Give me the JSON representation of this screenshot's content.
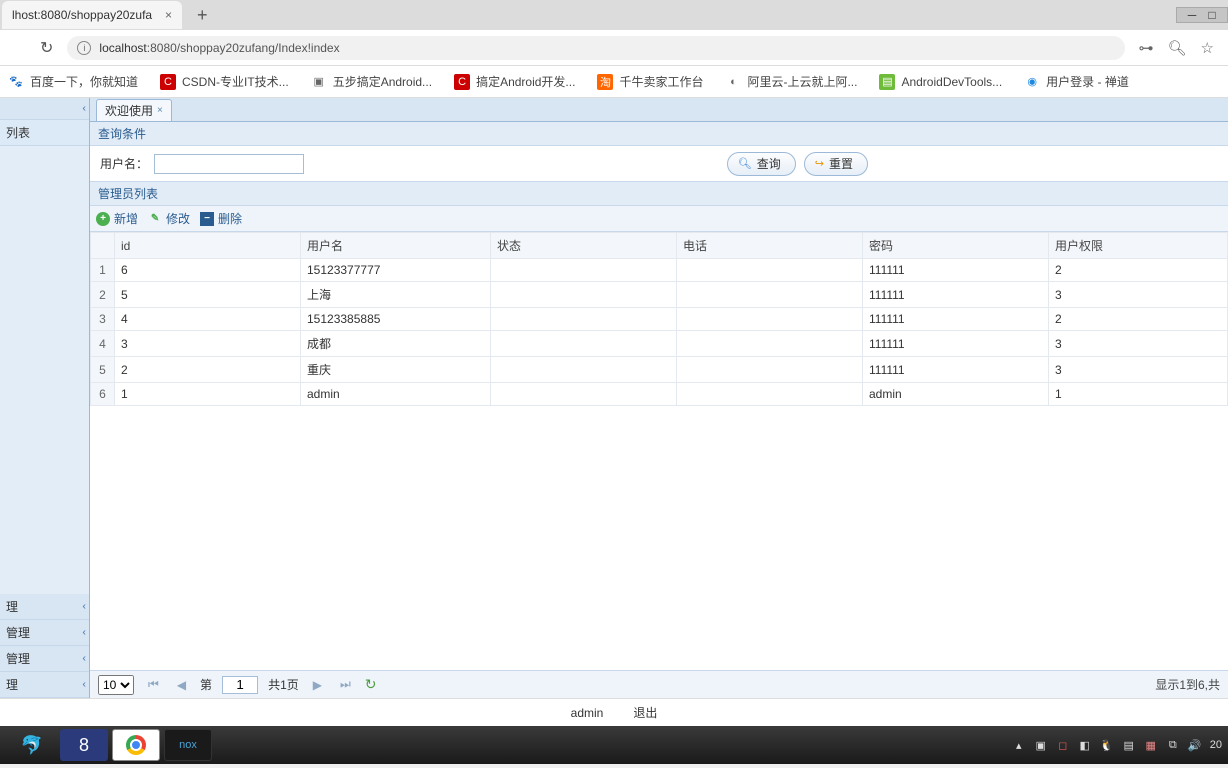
{
  "browser": {
    "tab_title": "lhost:8080/shoppay20zufa",
    "url_display_host": "localhost",
    "url_display_rest": ":8080/shoppay20zufang/Index!index"
  },
  "bookmarks": [
    {
      "label": "百度一下，你就知道"
    },
    {
      "label": "CSDN-专业IT技术..."
    },
    {
      "label": "五步搞定Android..."
    },
    {
      "label": "搞定Android开发..."
    },
    {
      "label": "千牛卖家工作台"
    },
    {
      "label": "阿里云-上云就上阿..."
    },
    {
      "label": "AndroidDevTools..."
    },
    {
      "label": "用户登录 - 禅道"
    }
  ],
  "sidebar": {
    "top_item": "列表",
    "bottom_items": [
      "理",
      "管理",
      "管理",
      "理"
    ]
  },
  "app": {
    "tab_label": "欢迎使用",
    "query_panel_title": "查询条件",
    "username_label": "用户名：",
    "search_label": "查询",
    "reset_label": "重置",
    "list_panel_title": "管理员列表",
    "toolbar": {
      "add": "新增",
      "edit": "修改",
      "delete": "删除"
    },
    "columns": {
      "id": "id",
      "username": "用户名",
      "status": "状态",
      "phone": "电话",
      "password": "密码",
      "perm": "用户权限"
    },
    "rows": [
      {
        "n": "1",
        "id": "6",
        "username": "15123377777",
        "status": "",
        "phone": "",
        "password": "111111",
        "perm": "2"
      },
      {
        "n": "2",
        "id": "5",
        "username": "上海",
        "status": "",
        "phone": "",
        "password": "111111",
        "perm": "3"
      },
      {
        "n": "3",
        "id": "4",
        "username": "15123385885",
        "status": "",
        "phone": "",
        "password": "111111",
        "perm": "2"
      },
      {
        "n": "4",
        "id": "3",
        "username": "成都",
        "status": "",
        "phone": "",
        "password": "111111",
        "perm": "3"
      },
      {
        "n": "5",
        "id": "2",
        "username": "重庆",
        "status": "",
        "phone": "",
        "password": "111111",
        "perm": "3"
      },
      {
        "n": "6",
        "id": "1",
        "username": "admin",
        "status": "",
        "phone": "",
        "password": "admin",
        "perm": "1"
      }
    ],
    "pager": {
      "page_size": "10",
      "page_label_prefix": "第",
      "page_current": "1",
      "page_total": "共1页",
      "summary": "显示1到6,共"
    }
  },
  "footer": {
    "user": "admin",
    "logout": "退出"
  },
  "taskbar": {
    "clock": "20"
  }
}
